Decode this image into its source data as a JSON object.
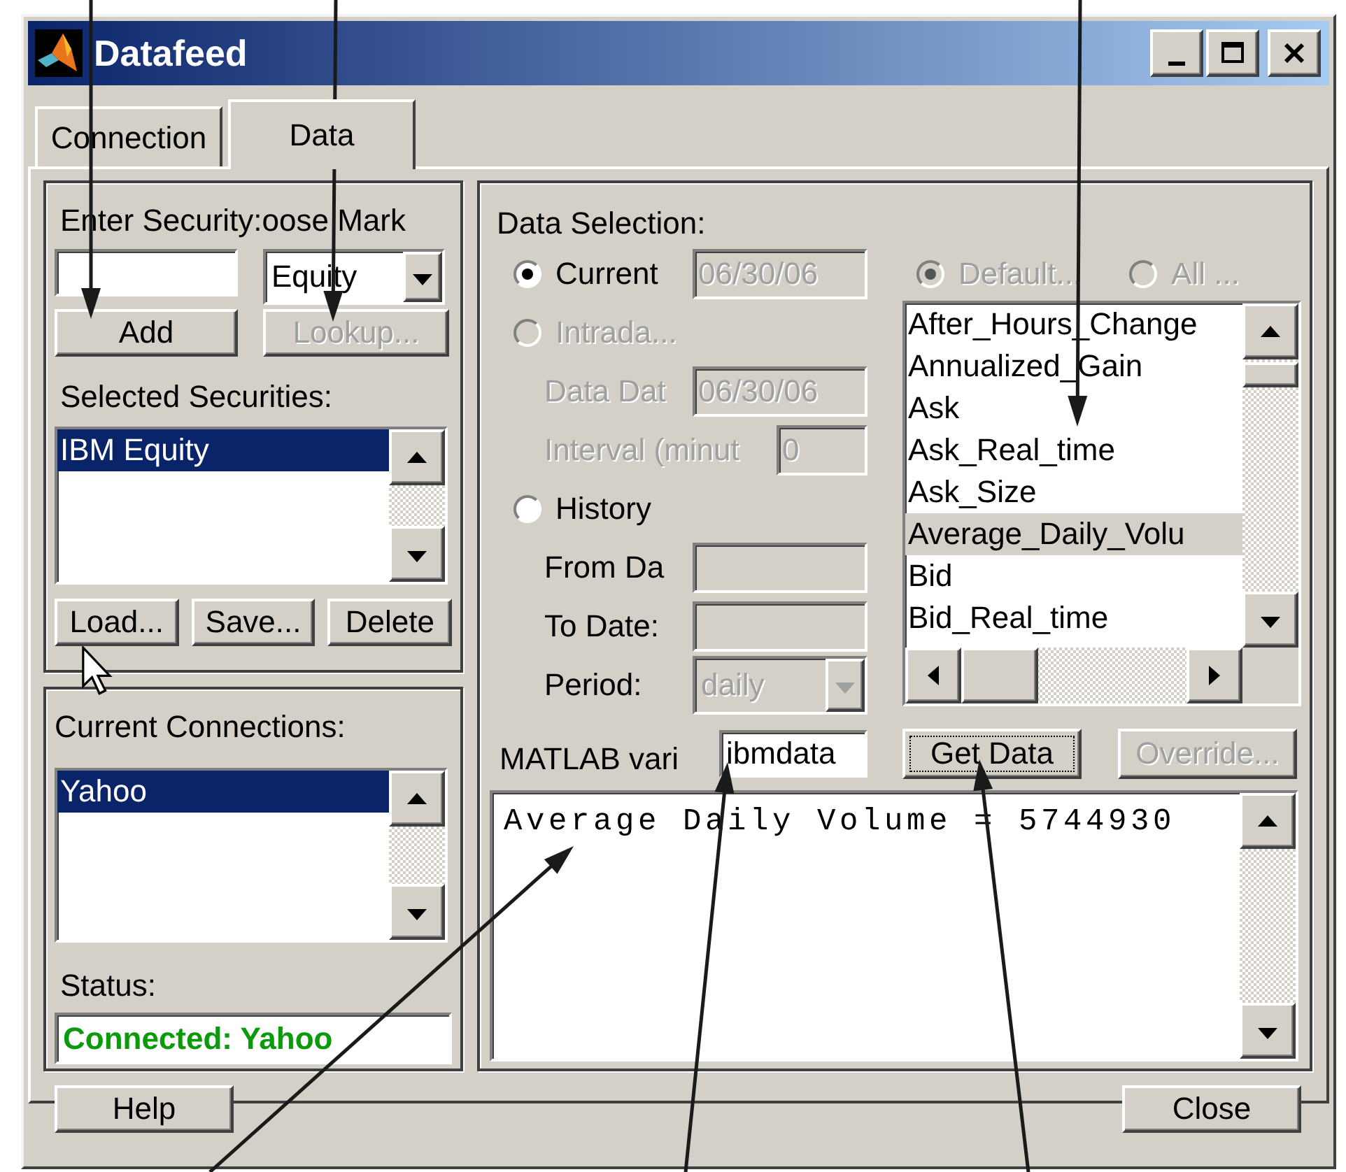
{
  "window": {
    "title": "Datafeed"
  },
  "tabs": [
    {
      "label": "Connection",
      "selected": false
    },
    {
      "label": "Data",
      "selected": true
    }
  ],
  "security": {
    "label": "Enter Security:",
    "market_label": "oose Mark",
    "market": {
      "value": "Equity"
    },
    "buttons": [
      {
        "label": "Add",
        "disabled": false
      },
      {
        "label": "Lookup...",
        "disabled": true
      }
    ],
    "selected_label": "Selected Securities:",
    "selected_list": {
      "focused": true,
      "items": [
        {
          "label": "IBM Equity",
          "selected": true
        }
      ]
    },
    "file_buttons": [
      "Load...",
      "Save...",
      "Delete"
    ]
  },
  "connections": {
    "label": "Current Connections:",
    "list": {
      "focused": true,
      "items": [
        {
          "label": "Yahoo",
          "selected": true
        }
      ]
    },
    "status_label": "Status:",
    "status": "Connected: Yahoo"
  },
  "data_selection": {
    "label": "Data Selection:",
    "modes": [
      {
        "label": "Current",
        "selected": true,
        "disabled": false,
        "value": "06/30/06"
      },
      {
        "label": "Intrada...",
        "selected": false,
        "disabled": true,
        "fields": [
          {
            "kind": "text",
            "label": "Data Dat",
            "value": "06/30/06"
          },
          {
            "kind": "short_text",
            "label": "Interval (minut",
            "value": "0"
          }
        ]
      },
      {
        "label": "History",
        "selected": false,
        "disabled": false,
        "fields": [
          {
            "kind": "text",
            "label": "From Da"
          },
          {
            "kind": "text",
            "label": "To Date:"
          },
          {
            "kind": "dropdown",
            "label": "Period:",
            "value": "daily"
          }
        ]
      }
    ],
    "scope": [
      {
        "label": "Default...",
        "selected": true,
        "disabled": true
      },
      {
        "label": "All ...",
        "selected": false,
        "disabled": true
      }
    ],
    "fields_list": {
      "focused": false,
      "items": [
        {
          "label": "After_Hours_Change",
          "selected": false
        },
        {
          "label": "Annualized_Gain",
          "selected": false
        },
        {
          "label": "Ask",
          "selected": false
        },
        {
          "label": "Ask_Real_time",
          "selected": false
        },
        {
          "label": "Ask_Size",
          "selected": false
        },
        {
          "label": "Average_Daily_Volu",
          "selected": true
        },
        {
          "label": "Bid",
          "selected": false
        },
        {
          "label": "Bid_Real_time",
          "selected": false
        }
      ]
    },
    "variable": {
      "label": "MATLAB vari",
      "value": "ibmdata"
    },
    "actions": [
      {
        "label": "Get Data",
        "disabled": false,
        "focused": true
      },
      {
        "label": "Override...",
        "disabled": true,
        "focused": false
      }
    ],
    "output": "Average Daily Volume = 5744930"
  },
  "footer_buttons": [
    "Help",
    "Close"
  ]
}
